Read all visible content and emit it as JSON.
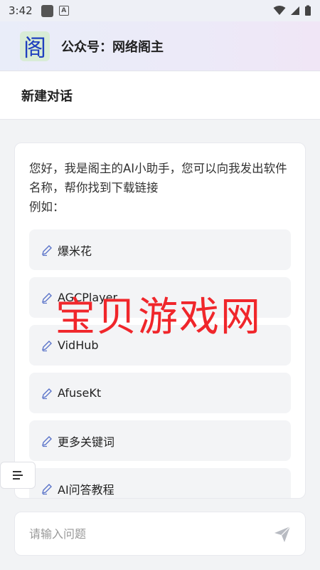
{
  "status_bar": {
    "time": "3:42"
  },
  "header": {
    "logo_char": "阁",
    "title": "公众号：网络阁主"
  },
  "subheader": {
    "title": "新建对话"
  },
  "chat": {
    "greeting_line1": "您好，我是阁主的AI小助手，您可以向我发出软件名称，帮你找到下载链接",
    "greeting_line2": "例如：",
    "suggestions": [
      {
        "label": "爆米花",
        "icon": "pencil-icon"
      },
      {
        "label": "AGCPlayer",
        "icon": "pencil-icon"
      },
      {
        "label": "VidHub",
        "icon": "pencil-icon"
      },
      {
        "label": "AfuseKt",
        "icon": "pencil-icon"
      },
      {
        "label": "更多关键词",
        "icon": "pencil-icon"
      },
      {
        "label": "AI问答教程",
        "icon": "pencil-icon"
      }
    ]
  },
  "watermark": "宝贝游戏网",
  "input": {
    "placeholder": "请输入问题",
    "send_icon": "send-icon"
  },
  "colors": {
    "accent": "#5b74c9",
    "watermark": "#f0262b"
  }
}
